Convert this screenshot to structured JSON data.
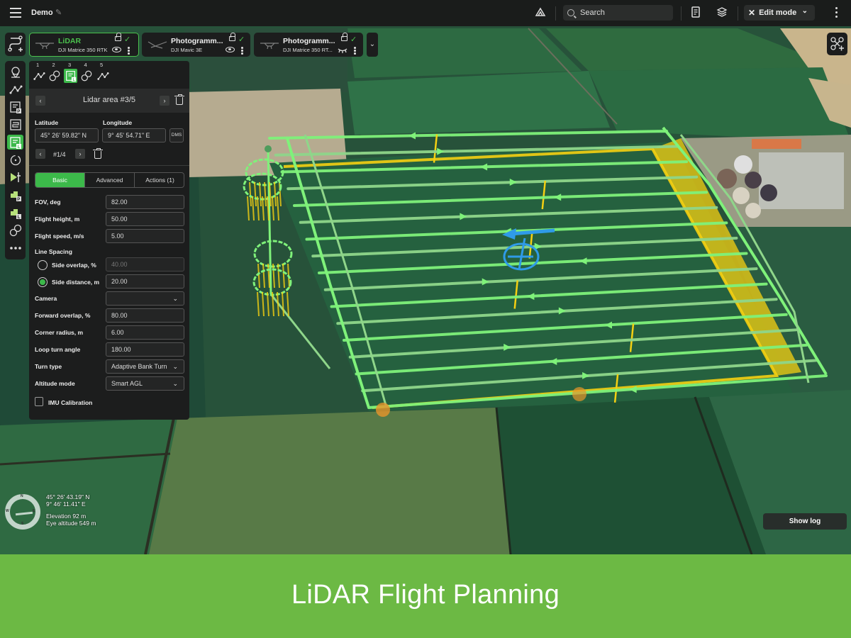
{
  "app": {
    "project_title": "Demo",
    "search_placeholder": "Search",
    "mode_label": "Edit mode"
  },
  "drones": [
    {
      "name": "LiDAR",
      "model": "DJI Matrice 350 RTK",
      "active": true,
      "visibility": "visible"
    },
    {
      "name": "Photogramm...",
      "model": "DJI Mavic 3E",
      "active": false,
      "visibility": "visible"
    },
    {
      "name": "Photogramm...",
      "model": "DJI Matrice 350 RT...",
      "active": false,
      "visibility": "hidden"
    }
  ],
  "sidebar": {
    "items": [
      {
        "icon": "waypoint-marker-icon",
        "active": false
      },
      {
        "icon": "polyline-route-icon",
        "active": false
      },
      {
        "icon": "photogrammetry-area-icon",
        "active": false
      },
      {
        "icon": "area-grid-icon",
        "active": false
      },
      {
        "icon": "lidar-area-icon",
        "active": true
      },
      {
        "icon": "orbit-icon",
        "active": false
      },
      {
        "icon": "facade-scan-icon",
        "active": false
      },
      {
        "icon": "corridor-photogrammetry-icon",
        "active": false
      },
      {
        "icon": "corridor-lidar-icon",
        "active": false
      },
      {
        "icon": "multi-orbit-icon",
        "active": false
      },
      {
        "icon": "more-icon",
        "active": false
      }
    ]
  },
  "tool_tabs": [
    {
      "num": "1",
      "icon": "polyline-route-icon",
      "active": false
    },
    {
      "num": "2",
      "icon": "multi-orbit-icon",
      "active": false
    },
    {
      "num": "3",
      "icon": "lidar-area-icon",
      "active": true
    },
    {
      "num": "4",
      "icon": "multi-orbit-icon",
      "active": false
    },
    {
      "num": "5",
      "icon": "polyline-route-icon",
      "active": false
    }
  ],
  "editor": {
    "area_title": "Lidar area #3/5",
    "latitude_label": "Latitude",
    "longitude_label": "Longitude",
    "latitude": "45° 26' 59.82\" N",
    "longitude": "9° 45' 54.71\" E",
    "coord_format_btn": "DMS",
    "vertex_index": "#1/4",
    "tabs": [
      {
        "label": "Basic",
        "active": true
      },
      {
        "label": "Advanced",
        "active": false
      },
      {
        "label": "Actions (1)",
        "active": false
      }
    ],
    "fields": {
      "fov": {
        "label": "FOV, deg",
        "value": "82.00"
      },
      "flight_height": {
        "label": "Flight height, m",
        "value": "50.00"
      },
      "flight_speed": {
        "label": "Flight speed, m/s",
        "value": "5.00"
      },
      "line_spacing_label": "Line Spacing",
      "side_overlap": {
        "label": "Side overlap, %",
        "value": "40.00",
        "selected": false
      },
      "side_distance": {
        "label": "Side distance, m",
        "value": "20.00",
        "selected": true
      },
      "camera": {
        "label": "Camera",
        "value": ""
      },
      "forward_overlap": {
        "label": "Forward overlap, %",
        "value": "80.00"
      },
      "corner_radius": {
        "label": "Corner radius, m",
        "value": "6.00"
      },
      "loop_turn_angle": {
        "label": "Loop turn angle",
        "value": "180.00"
      },
      "turn_type": {
        "label": "Turn type",
        "value": "Adaptive Bank Turn"
      },
      "altitude_mode": {
        "label": "Altitude mode",
        "value": "Smart AGL"
      },
      "imu_calibration": {
        "label": "IMU Calibration",
        "checked": false
      }
    }
  },
  "map_info": {
    "compass": {
      "n": "N",
      "e": "E",
      "s": "S",
      "w": "W"
    },
    "cursor_lat": "45° 26' 43.19\" N",
    "cursor_lon": "9° 46' 11.41\" E",
    "elevation": "Elevation 92 m",
    "eye_altitude": "Eye altitude 549 m",
    "show_log_label": "Show log"
  },
  "colors": {
    "accent": "#3cb94a",
    "path": "#7ff27a",
    "ground_line": "#f5d012",
    "home": "#2f9be8",
    "banner": "#6cb944"
  },
  "banner": {
    "title": "LiDAR Flight Planning"
  }
}
